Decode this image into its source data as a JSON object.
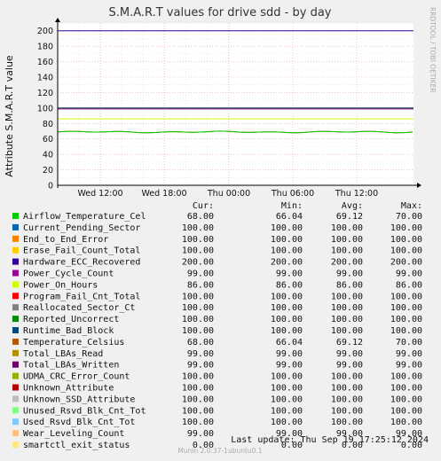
{
  "chart_data": {
    "type": "line",
    "title": "S.M.A.R.T values for drive sdd - by day",
    "ylabel": "Attribute S.M.A.R.T value",
    "ylim": [
      0,
      210
    ],
    "y_ticks": [
      "0",
      "20",
      "40",
      "60",
      "80",
      "100",
      "120",
      "140",
      "160",
      "180",
      "200"
    ],
    "x_ticks": [
      "Wed 12:00",
      "Wed 18:00",
      "Thu 00:00",
      "Thu 06:00",
      "Thu 12:00"
    ],
    "grid": true,
    "side_text": "RRDTOOL / TOBI OETIKER",
    "columns": [
      "Cur:",
      "Min:",
      "Avg:",
      "Max:"
    ],
    "series": [
      {
        "name": "Airflow_Temperature_Cel",
        "color": "#00cc00",
        "cur": "68.00",
        "min": "66.04",
        "avg": "69.12",
        "max": "70.00",
        "value": 68,
        "wavy": true
      },
      {
        "name": "Current_Pending_Sector",
        "color": "#0066b3",
        "cur": "100.00",
        "min": "100.00",
        "avg": "100.00",
        "max": "100.00",
        "value": 100
      },
      {
        "name": "End_to_End_Error",
        "color": "#ff8000",
        "cur": "100.00",
        "min": "100.00",
        "avg": "100.00",
        "max": "100.00",
        "value": 100
      },
      {
        "name": "Erase_Fail_Count_Total",
        "color": "#ffcc00",
        "cur": "100.00",
        "min": "100.00",
        "avg": "100.00",
        "max": "100.00",
        "value": 100
      },
      {
        "name": "Hardware_ECC_Recovered",
        "color": "#330099",
        "cur": "200.00",
        "min": "200.00",
        "avg": "200.00",
        "max": "200.00",
        "value": 200
      },
      {
        "name": "Power_Cycle_Count",
        "color": "#990099",
        "cur": "99.00",
        "min": "99.00",
        "avg": "99.00",
        "max": "99.00",
        "value": 99
      },
      {
        "name": "Power_On_Hours",
        "color": "#ccff00",
        "cur": "86.00",
        "min": "86.00",
        "avg": "86.00",
        "max": "86.00",
        "value": 86
      },
      {
        "name": "Program_Fail_Cnt_Total",
        "color": "#ff0000",
        "cur": "100.00",
        "min": "100.00",
        "avg": "100.00",
        "max": "100.00",
        "value": 100
      },
      {
        "name": "Reallocated_Sector_Ct",
        "color": "#808080",
        "cur": "100.00",
        "min": "100.00",
        "avg": "100.00",
        "max": "100.00",
        "value": 100
      },
      {
        "name": "Reported_Uncorrect",
        "color": "#008f00",
        "cur": "100.00",
        "min": "100.00",
        "avg": "100.00",
        "max": "100.00",
        "value": 100
      },
      {
        "name": "Runtime_Bad_Block",
        "color": "#00487d",
        "cur": "100.00",
        "min": "100.00",
        "avg": "100.00",
        "max": "100.00",
        "value": 100
      },
      {
        "name": "Temperature_Celsius",
        "color": "#b35a00",
        "cur": "68.00",
        "min": "66.04",
        "avg": "69.12",
        "max": "70.00",
        "value": 68,
        "wavy": true
      },
      {
        "name": "Total_LBAs_Read",
        "color": "#b38f00",
        "cur": "99.00",
        "min": "99.00",
        "avg": "99.00",
        "max": "99.00",
        "value": 99
      },
      {
        "name": "Total_LBAs_Written",
        "color": "#6b006b",
        "cur": "99.00",
        "min": "99.00",
        "avg": "99.00",
        "max": "99.00",
        "value": 99
      },
      {
        "name": "UDMA_CRC_Error_Count",
        "color": "#8fb300",
        "cur": "100.00",
        "min": "100.00",
        "avg": "100.00",
        "max": "100.00",
        "value": 100
      },
      {
        "name": "Unknown_Attribute",
        "color": "#b30000",
        "cur": "100.00",
        "min": "100.00",
        "avg": "100.00",
        "max": "100.00",
        "value": 100
      },
      {
        "name": "Unknown_SSD_Attribute",
        "color": "#bebebe",
        "cur": "100.00",
        "min": "100.00",
        "avg": "100.00",
        "max": "100.00",
        "value": 100
      },
      {
        "name": "Unused_Rsvd_Blk_Cnt_Tot",
        "color": "#80ff80",
        "cur": "100.00",
        "min": "100.00",
        "avg": "100.00",
        "max": "100.00",
        "value": 100
      },
      {
        "name": "Used_Rsvd_Blk_Cnt_Tot",
        "color": "#80c9ff",
        "cur": "100.00",
        "min": "100.00",
        "avg": "100.00",
        "max": "100.00",
        "value": 100
      },
      {
        "name": "Wear_Leveling_Count",
        "color": "#ffc080",
        "cur": "99.00",
        "min": "99.00",
        "avg": "99.00",
        "max": "99.00",
        "value": 99
      },
      {
        "name": "smartctl_exit_status",
        "color": "#ffe680",
        "cur": "0.00",
        "min": "0.00",
        "avg": "0.00",
        "max": "0.00",
        "value": 0
      }
    ],
    "last_update": "Last update: Thu Sep 19 17:25:12 2024",
    "footer": "Munin 2.0.37-1ubuntu0.1"
  }
}
